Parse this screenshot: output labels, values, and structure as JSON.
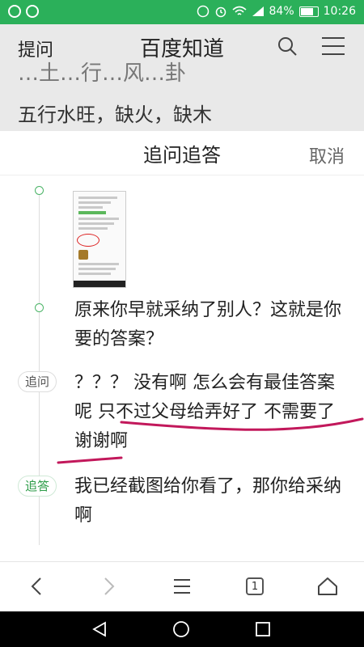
{
  "status_bar": {
    "battery": "84%",
    "time": "10:26"
  },
  "background_page": {
    "left_label": "提问",
    "title": "百度知道",
    "partial_line": "…土…行…风…卦",
    "line": "五行水旺，缺火，缺木"
  },
  "sheet": {
    "title": "追问追答",
    "cancel_label": "取消",
    "messages": [
      {
        "tag": "",
        "text": "原来你早就采纳了别人？这就是你要的答案？"
      },
      {
        "tag": "追问",
        "text": "？？？ 没有啊 怎么会有最佳答案呢 只不过父母给弄好了 不需要了 谢谢啊"
      },
      {
        "tag": "追答",
        "text": "我已经截图给你看了，那你给采纳啊"
      }
    ]
  },
  "browser_nav": {
    "tab_count": "1"
  },
  "colors": {
    "status_bar": "#2bb05a",
    "accent_green": "#49b365",
    "annotation_red": "#c2185b"
  }
}
